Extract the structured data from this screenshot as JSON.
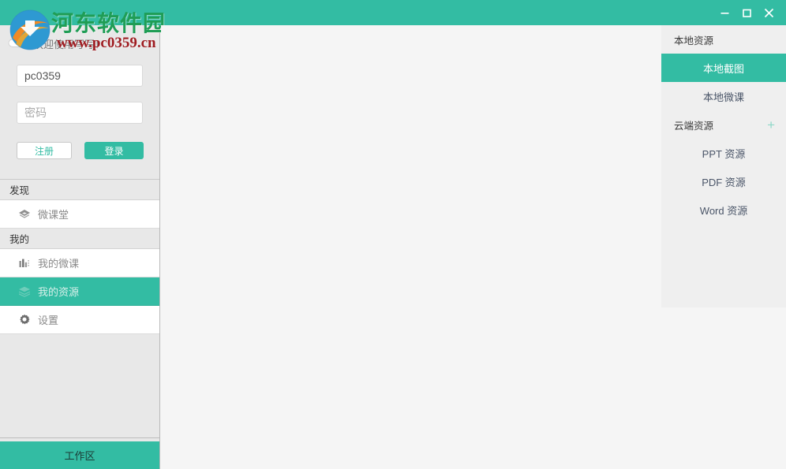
{
  "window": {
    "accent_color": "#33bca3",
    "controls": [
      {
        "name": "minimize",
        "glyph": "−"
      },
      {
        "name": "maximize",
        "glyph": "□"
      },
      {
        "name": "close",
        "glyph": "×"
      }
    ]
  },
  "watermark": {
    "site_name": "河东软件园",
    "url": "www.pc0359.cn",
    "site_color": "#1f9d55",
    "url_color": "#9e1b20"
  },
  "login": {
    "welcome": "欢迎使用写写！",
    "username_value": "pc0359",
    "password_placeholder": "密码",
    "register_label": "注册",
    "login_label": "登录"
  },
  "sidebar": {
    "sections": [
      {
        "title": "发现",
        "items": [
          {
            "label": "微课堂",
            "icon": "gem-icon",
            "active": false
          }
        ]
      },
      {
        "title": "我的",
        "items": [
          {
            "label": "我的微课",
            "icon": "bar-chart-icon",
            "active": false
          },
          {
            "label": "我的资源",
            "icon": "layers-icon",
            "active": true
          },
          {
            "label": "设置",
            "icon": "gear-icon",
            "active": false
          }
        ]
      }
    ],
    "workspace_label": "工作区"
  },
  "resources": {
    "local_group_label": "本地资源",
    "local_items": [
      {
        "label": "本地截图",
        "active": true
      },
      {
        "label": "本地微课",
        "active": false
      }
    ],
    "cloud_group_label": "云端资源",
    "cloud_add_glyph": "+",
    "cloud_items": [
      {
        "label": "PPT 资源",
        "active": false
      },
      {
        "label": "PDF 资源",
        "active": false
      },
      {
        "label": "Word 资源",
        "active": false
      }
    ]
  }
}
